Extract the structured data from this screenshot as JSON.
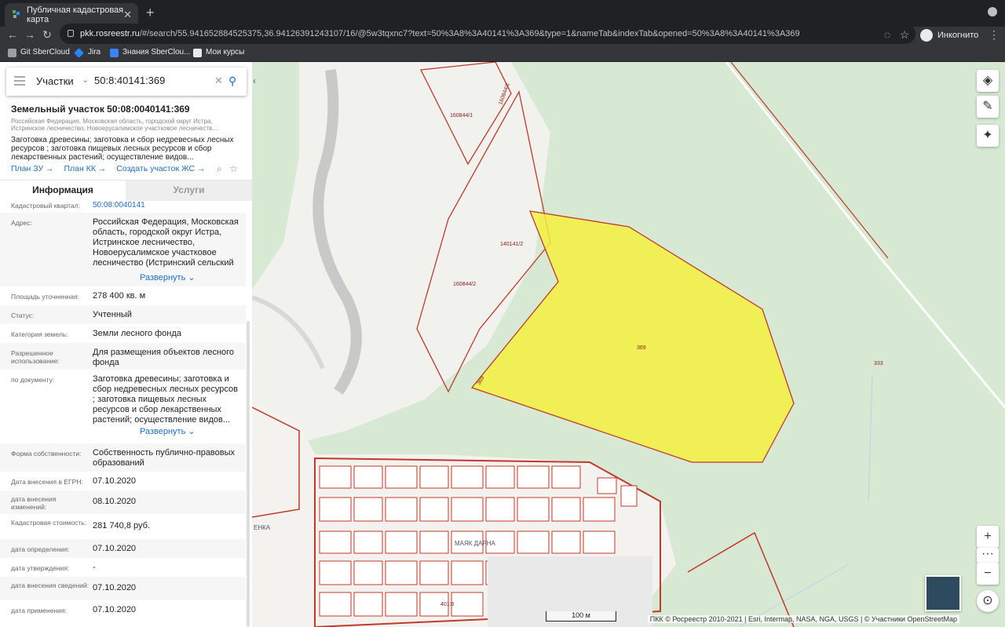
{
  "browser": {
    "tab_title": "Публичная кадастровая карта",
    "url_host": "pkk.rosreestr.ru",
    "url_path": "/#/search/55.941652884525375,36.94126391243107/16/@5w3tqxnc7?text=50%3A8%3A40141%3A369&type=1&nameTab&indexTab&opened=50%3A8%3A40141%3A369",
    "profile_label": "Инкогнито",
    "bookmarks": [
      "Git SberCloud",
      "Jira",
      "Знания SberClou...",
      "Мои курсы"
    ]
  },
  "search": {
    "type_label": "Участки",
    "query": "50:8:40141:369"
  },
  "parcel": {
    "title": "Земельный участок 50:08:0040141:369",
    "subtitle": "Российская Федерация, Московская область, городской округ Истра, Истринское лесничество, Новоерусалимское участковое лесничеств...",
    "purpose": "Заготовка древесины; заготовка и сбор недревесных лесных ресурсов ; заготовка пищевых лесных ресурсов и сбор лекарственных растений; осуществление видов...",
    "links": [
      "План ЗУ →",
      "План КК →",
      "Создать участок ЖС →"
    ]
  },
  "tabs": {
    "info": "Информация",
    "services": "Услуги"
  },
  "fields": {
    "quarter_label": "Кадастровый квартал:",
    "quarter_value": "50:08:0040141",
    "address_label": "Адрес:",
    "address_value": "Российская Федерация, Московская область, городской округ Истра, Истринское лесничество, Новоерусалимское участковое лесничество (Истринский сельский участок...",
    "expand_label": "Развернуть",
    "area_label": "Площадь уточненная:",
    "area_value": "278 400 кв. м",
    "status_label": "Статус:",
    "status_value": "Учтенный",
    "category_label": "Категория земель:",
    "category_value": "Земли лесного фонда",
    "use_label": "Разрешенное использование:",
    "use_value": "Для размещения объектов лесного фонда",
    "doc_label": "по документу:",
    "doc_value": "Заготовка древесины; заготовка и сбор недревесных лесных ресурсов ; заготовка пищевых лесных ресурсов и сбор лекарственных растений; осуществление видов...",
    "ownership_label": "Форма собственности:",
    "ownership_value": "Собственность публично-правовых образований",
    "egrn_label": "Дата внесения в ЕГРН:",
    "egrn_value": "07.10.2020",
    "changes_label": "дата внесения изменений:",
    "changes_value": "08.10.2020",
    "cost_label": "Кадастровая стоимость:",
    "cost_value": "281 740,8 руб.",
    "def_label": "дата определения:",
    "def_value": "07.10.2020",
    "approve_label": "дата утверждения:",
    "approve_value": "-",
    "info_label": "дата внесения сведений:",
    "info_value": "07.10.2020",
    "apply_label": "дата применения:",
    "apply_value": "07.10.2020"
  },
  "map": {
    "labels": [
      "160844/1",
      "160844/1",
      "140141/2",
      "160844/2",
      "369",
      "369",
      "333",
      "МАЯК ДАРНА",
      "ЕНКА",
      "401:6"
    ],
    "scale_label": "100 м",
    "attribution": "ПКК © Росреестр 2010-2021 | Esri, Intermap, NASA, NGA, USGS | © Участники OpenStreetMap",
    "highlight_color": "#f5f23a",
    "boundary_color": "#c0392b"
  }
}
